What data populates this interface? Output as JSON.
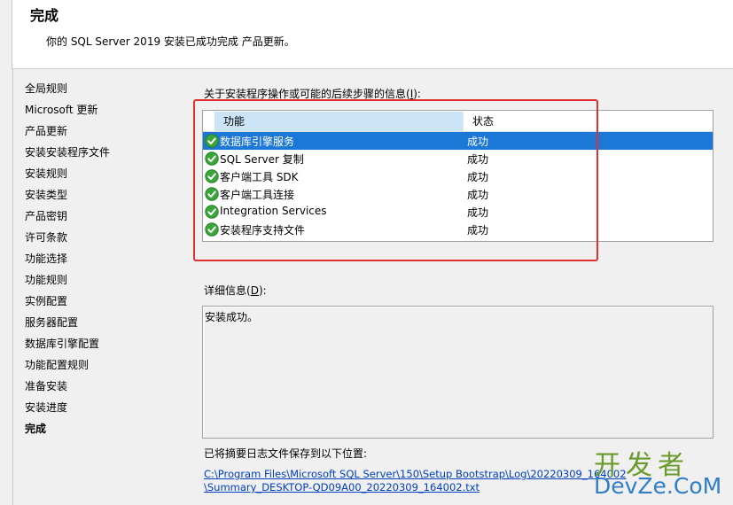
{
  "header": {
    "title": "完成",
    "subtitle": "你的 SQL Server 2019 安装已成功完成 产品更新。"
  },
  "sidebar": {
    "steps": [
      {
        "label": "全局规则"
      },
      {
        "label": "Microsoft 更新"
      },
      {
        "label": "产品更新"
      },
      {
        "label": "安装安装程序文件"
      },
      {
        "label": "安装规则"
      },
      {
        "label": "安装类型"
      },
      {
        "label": "产品密钥"
      },
      {
        "label": "许可条款"
      },
      {
        "label": "功能选择"
      },
      {
        "label": "功能规则"
      },
      {
        "label": "实例配置"
      },
      {
        "label": "服务器配置"
      },
      {
        "label": "数据库引擎配置"
      },
      {
        "label": "功能配置规则"
      },
      {
        "label": "准备安装"
      },
      {
        "label": "安装进度"
      },
      {
        "label": "完成"
      }
    ],
    "current": "完成"
  },
  "main": {
    "info_label_prefix": "关于安装程序操作或可能的后续步骤的信息(",
    "info_label_key": "I",
    "info_label_suffix": "):",
    "grid": {
      "columns": {
        "feature": "功能",
        "status": "状态"
      },
      "rows": [
        {
          "feature": "数据库引擎服务",
          "status": "成功",
          "icon": "success-check-icon"
        },
        {
          "feature": "SQL Server 复制",
          "status": "成功",
          "icon": "success-check-icon"
        },
        {
          "feature": "客户端工具 SDK",
          "status": "成功",
          "icon": "success-check-icon"
        },
        {
          "feature": "客户端工具连接",
          "status": "成功",
          "icon": "success-check-icon"
        },
        {
          "feature": "Integration Services",
          "status": "成功",
          "icon": "success-check-icon"
        },
        {
          "feature": "安装程序支持文件",
          "status": "成功",
          "icon": "success-check-icon"
        }
      ]
    },
    "details_label_prefix": "详细信息(",
    "details_label_key": "D",
    "details_label_suffix": "):",
    "details_text": "安装成功。",
    "log_label": "已将摘要日志文件保存到以下位置:",
    "log_path_line1": "C:\\Program Files\\Microsoft SQL Server\\150\\Setup Bootstrap\\Log\\20220309_164002",
    "log_path_line2": "\\Summary_DESKTOP-QD09A00_20220309_164002.txt"
  },
  "watermark": {
    "cn": "开发者",
    "en": "DevZe.CoM"
  },
  "colors": {
    "selection": "#1c78d6",
    "header_highlight": "#cce4f7",
    "annotation_box": "#e03030",
    "link": "#0040c0",
    "success_green": "#3aa53a"
  }
}
